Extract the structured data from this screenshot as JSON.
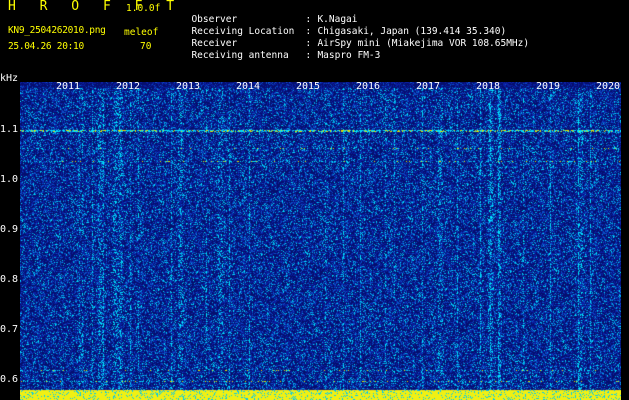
{
  "header": {
    "app_title": "H R O F F T",
    "version": "1.0.0f",
    "filename": "KN9_2504262010.png",
    "meleof_label": "meleof",
    "datetime": "25.04.26 20:10",
    "meleof_value": "70"
  },
  "info": [
    {
      "key": "Observer",
      "sep": ":",
      "value": "K.Nagai"
    },
    {
      "key": "Receiving Location",
      "sep": ":",
      "value": "Chigasaki, Japan (139.414 35.340)"
    },
    {
      "key": "Receiver",
      "sep": ":",
      "value": "AirSpy mini (Miakejima VOR 108.65MHz)"
    },
    {
      "key": "Receiving antenna",
      "sep": ":",
      "value": "Maspro FM-3"
    }
  ],
  "axis": {
    "y_unit": "kHz",
    "y_ticks": [
      "1.1",
      "1.0",
      "0.9",
      "0.8",
      "0.7",
      "0.6"
    ],
    "x_ticks": [
      "2011",
      "2012",
      "2013",
      "2014",
      "2015",
      "2016",
      "2017",
      "2018",
      "2019",
      "2020"
    ]
  },
  "colors": {
    "background": "#000000",
    "spectrogram_base": "#0a1a9a",
    "noise_cyan": "#00e5ff",
    "signal_yellow": "#ffff00",
    "label_yellow": "#ffff00",
    "label_white": "#ffffff"
  }
}
